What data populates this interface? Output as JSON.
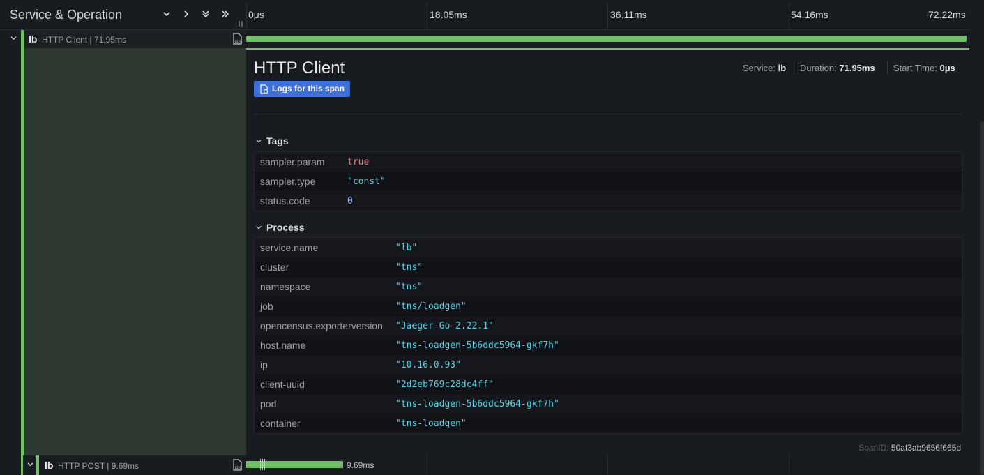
{
  "header": {
    "title": "Service & Operation",
    "ticks": [
      "0μs",
      "18.05ms",
      "36.11ms",
      "54.16ms",
      "72.22ms"
    ]
  },
  "colors": {
    "accent_green": "#73bf69",
    "button_blue": "#3d71d9",
    "string_value": "#59d4e6",
    "bool_value": "#ff7383",
    "number_value": "#8ab8ff"
  },
  "span1": {
    "service": "lb",
    "operation": "HTTP Client | 71.95ms"
  },
  "detail": {
    "title": "HTTP Client",
    "logs_button": "Logs for this span",
    "service_label": "Service:",
    "service_value": "lb",
    "duration_label": "Duration:",
    "duration_value": "71.95ms",
    "start_label": "Start Time:",
    "start_value": "0μs",
    "tags_title": "Tags",
    "tags": [
      {
        "key": "sampler.param",
        "value": "true",
        "type": "bool"
      },
      {
        "key": "sampler.type",
        "value": "\"const\"",
        "type": "str"
      },
      {
        "key": "status.code",
        "value": "0",
        "type": "num"
      }
    ],
    "process_title": "Process",
    "process": [
      {
        "key": "service.name",
        "value": "\"lb\""
      },
      {
        "key": "cluster",
        "value": "\"tns\""
      },
      {
        "key": "namespace",
        "value": "\"tns\""
      },
      {
        "key": "job",
        "value": "\"tns/loadgen\""
      },
      {
        "key": "opencensus.exporterversion",
        "value": "\"Jaeger-Go-2.22.1\""
      },
      {
        "key": "host.name",
        "value": "\"tns-loadgen-5b6ddc5964-gkf7h\""
      },
      {
        "key": "ip",
        "value": "\"10.16.0.93\""
      },
      {
        "key": "client-uuid",
        "value": "\"2d2eb769c28dc4ff\""
      },
      {
        "key": "pod",
        "value": "\"tns-loadgen-5b6ddc5964-gkf7h\""
      },
      {
        "key": "container",
        "value": "\"tns-loadgen\""
      }
    ],
    "spanid_label": "SpanID:",
    "spanid_value": "50af3ab9656f665d"
  },
  "span2": {
    "service": "lb",
    "operation": "HTTP POST | 9.69ms",
    "duration_label": "9.69ms"
  }
}
